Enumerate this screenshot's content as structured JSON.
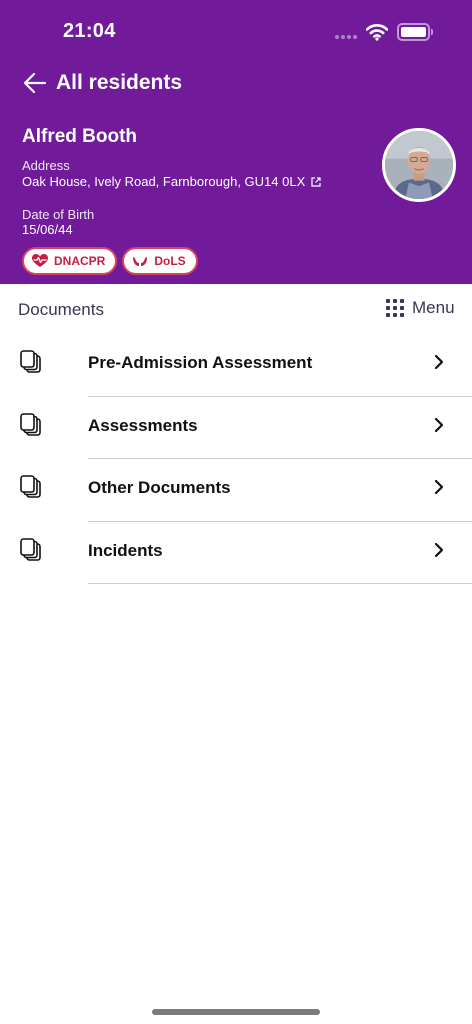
{
  "status_bar": {
    "time": "21:04"
  },
  "nav": {
    "back_label": "All residents"
  },
  "resident": {
    "name": "Alfred Booth",
    "address_label": "Address",
    "address": "Oak House, Ively Road, Farnborough, GU14 0LX",
    "dob_label": "Date of Birth",
    "dob": "15/06/44",
    "avatar_icon": "resident-photo",
    "badges": [
      {
        "label": "DNACPR",
        "icon": "heart-pulse-icon"
      },
      {
        "label": "DoLS",
        "icon": "hands-icon"
      }
    ]
  },
  "documents": {
    "title": "Documents",
    "menu_label": "Menu",
    "items": [
      {
        "label": "Pre-Admission Assessment"
      },
      {
        "label": "Assessments"
      },
      {
        "label": "Other Documents"
      },
      {
        "label": "Incidents"
      }
    ]
  },
  "colors": {
    "header": "#711b9b",
    "badge_accent": "#c41f43",
    "text_dark": "#111111",
    "muted_title": "#3a3657"
  }
}
